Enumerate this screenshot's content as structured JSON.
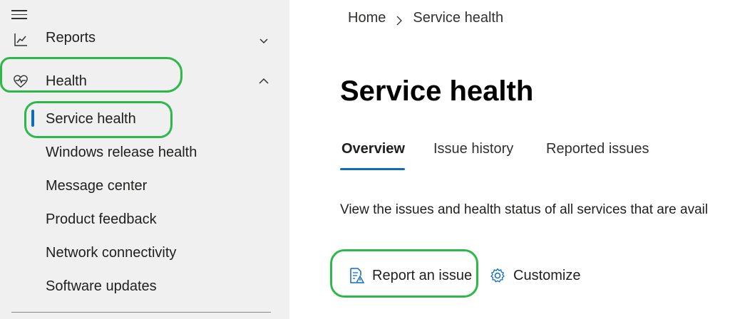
{
  "sidebar": {
    "menu_icon": "hamburger-icon",
    "reports_label": "Reports",
    "health_label": "Health",
    "sub_items": [
      "Service health",
      "Windows release health",
      "Message center",
      "Product feedback",
      "Network connectivity",
      "Software updates"
    ]
  },
  "breadcrumb": {
    "home": "Home",
    "current": "Service health"
  },
  "page_title": "Service health",
  "tabs": [
    "Overview",
    "Issue history",
    "Reported issues"
  ],
  "description": "View the issues and health status of all services that are avail",
  "commands": {
    "report_issue": "Report an issue",
    "customize": "Customize"
  },
  "colors": {
    "accent": "#0f6cbd",
    "annotation": "#2fb84a",
    "sidebar_bg": "#f0f0f0"
  }
}
